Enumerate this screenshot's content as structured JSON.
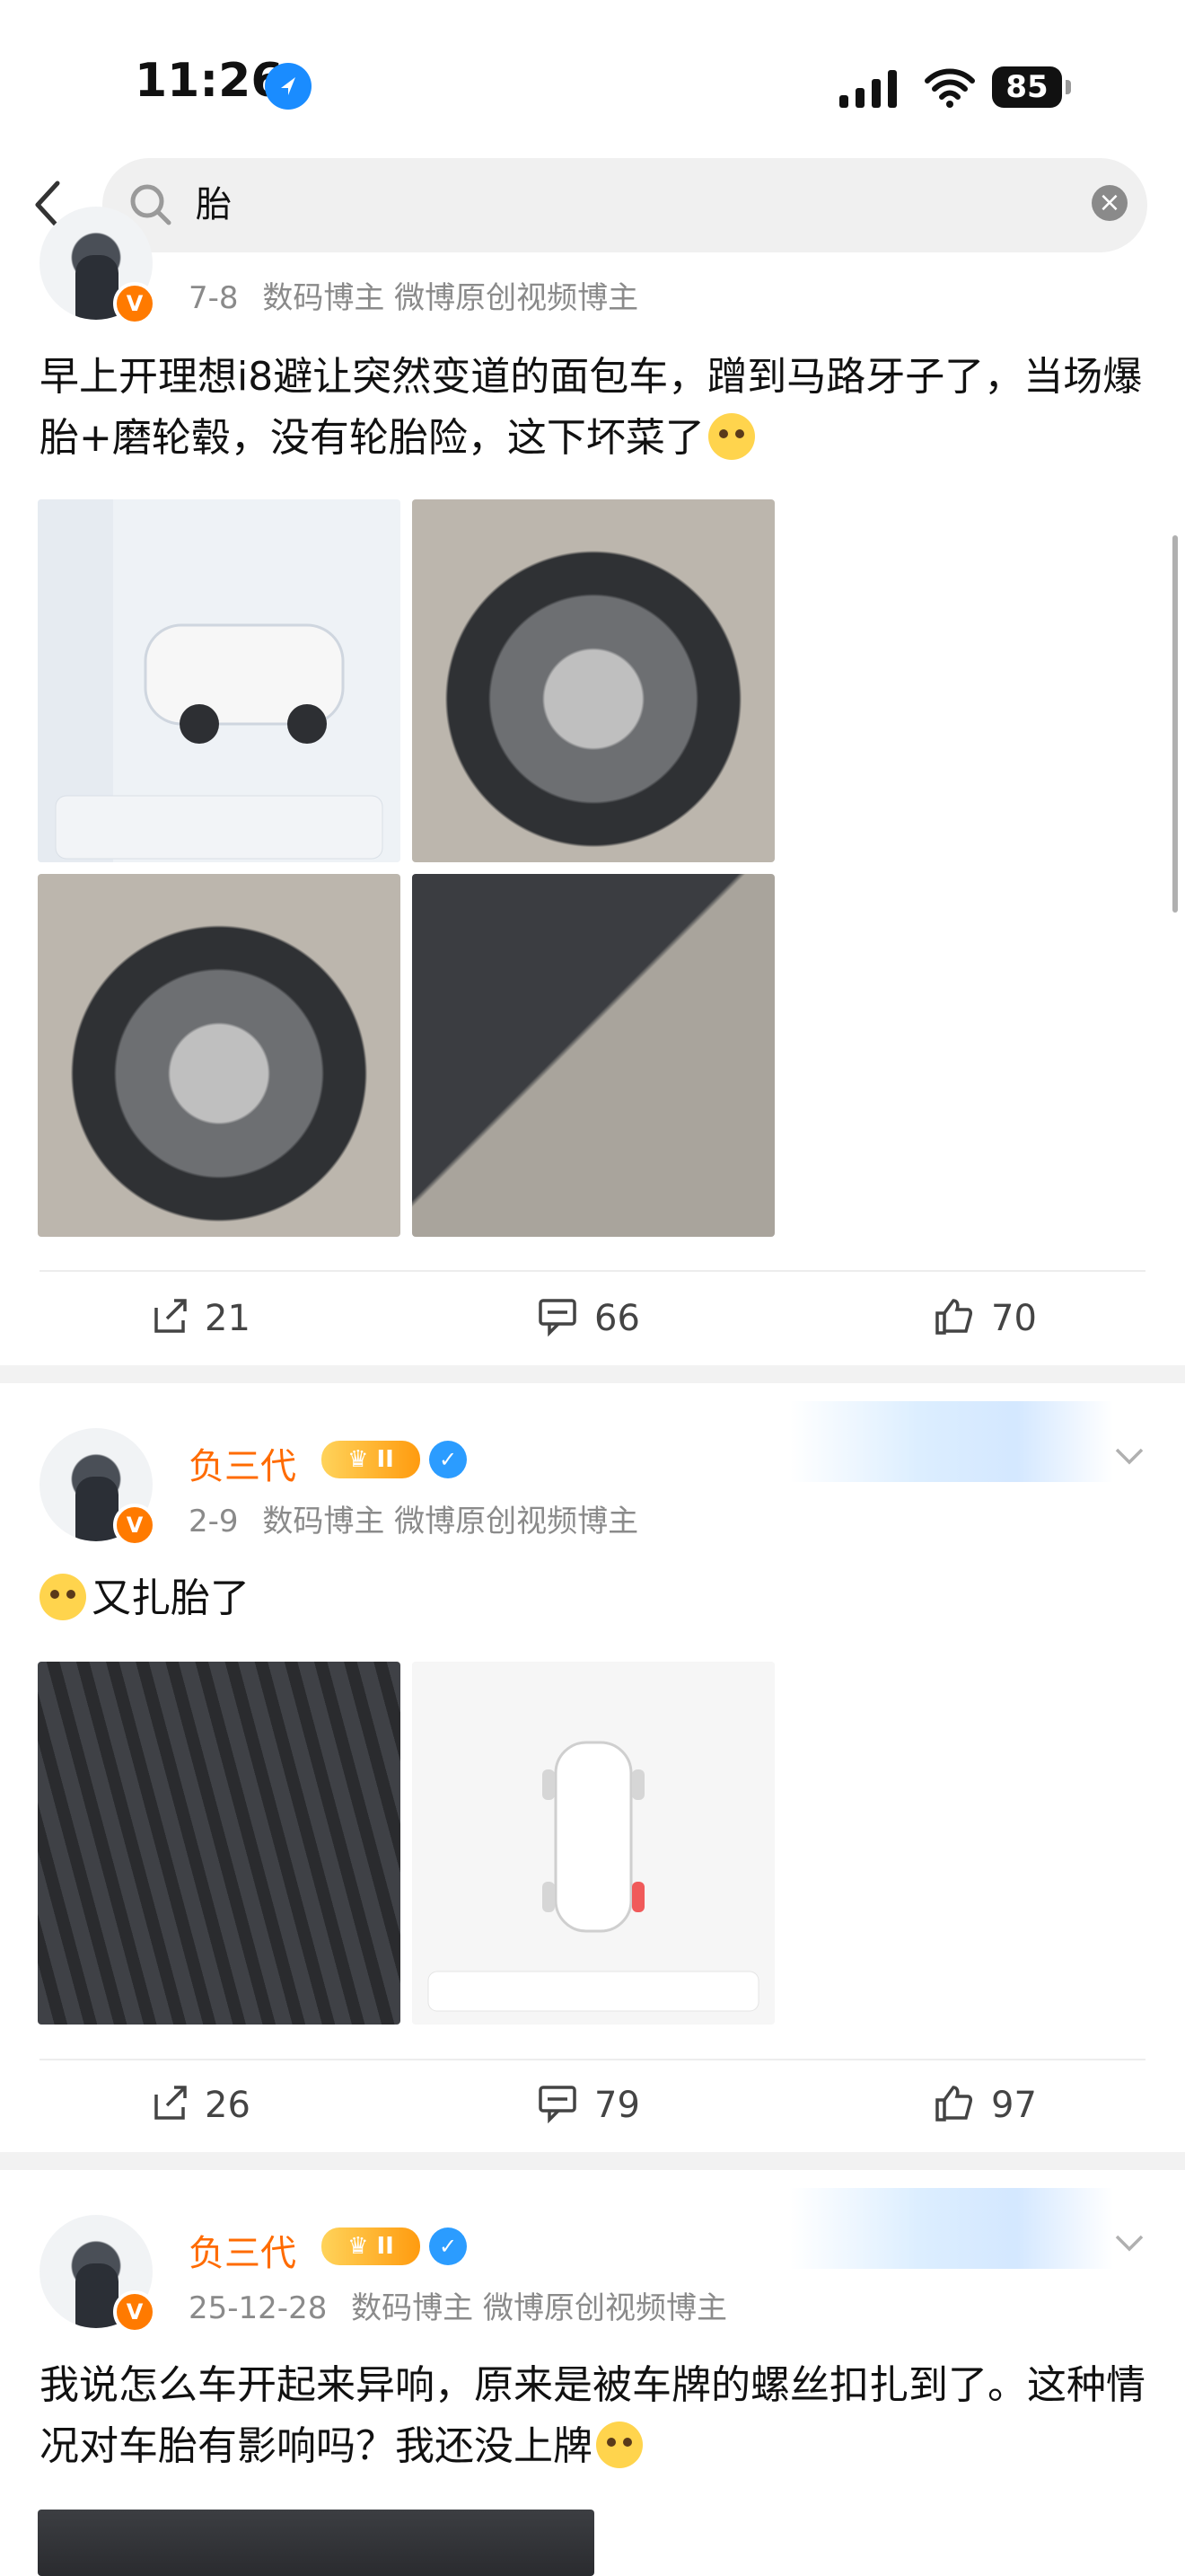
{
  "status": {
    "time": "11:26",
    "battery": "85"
  },
  "search": {
    "query": "胎"
  },
  "posts": [
    {
      "date": "7-8",
      "tags": "数码博主 微博原创视频博主",
      "text": "早上开理想i8避让突然变道的面包车，蹭到马路牙子了，当场爆胎+磨轮毂，没有轮胎险，这下坏菜了",
      "actions": {
        "reposts": "21",
        "comments": "66",
        "likes": "70"
      }
    },
    {
      "name": "负三代",
      "level": "II",
      "date": "2-9",
      "tags": "数码博主 微博原创视频博主",
      "text": "又扎胎了",
      "actions": {
        "reposts": "26",
        "comments": "79",
        "likes": "97"
      }
    },
    {
      "name": "负三代",
      "level": "II",
      "date": "25-12-28",
      "tags": "数码博主 微博原创视频博主",
      "text": "我说怎么车开起来异响，原来是被车牌的螺丝扣扎到了。这种情况对车胎有影响吗？我还没上牌"
    }
  ],
  "colors": {
    "accent_orange": "#ff6b00",
    "verified_blue": "#2b9cff"
  }
}
